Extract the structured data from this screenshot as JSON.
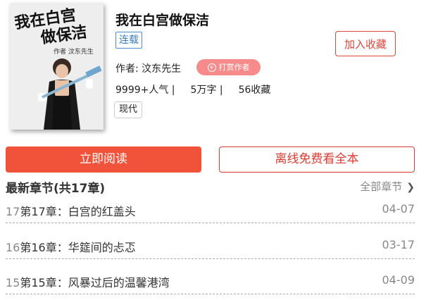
{
  "book": {
    "cover": {
      "title_line1": "我在白宫",
      "title_line2": "做保洁",
      "author_text": "作者 汶东先生"
    },
    "title": "我在白宫做保洁",
    "status_tag": "连载",
    "add_favorite_label": "加入收藏",
    "author_line": "作者: 汶东先生",
    "tip_label": "打赏作者",
    "stats": {
      "popularity": "9999+人气 |",
      "words": "5万字 |",
      "favorites": "56收藏"
    },
    "genre": "现代"
  },
  "actions": {
    "read_now": "立即阅读",
    "offline_read": "离线免费看全本"
  },
  "chapters": {
    "header": "最新章节(共17章)",
    "all_chapters": "全部章节",
    "items": [
      {
        "num": "17",
        "title": "第17章：白宫的红盖头",
        "date": "04-07"
      },
      {
        "num": "16",
        "title": "第16章：华筵间的忐忑",
        "date": "03-17"
      },
      {
        "num": "15",
        "title": "第15章：风暴过后的温馨港湾",
        "date": "04-09"
      }
    ]
  },
  "colors": {
    "primary_red": "#f1533a",
    "outline_red": "#d93b33",
    "tag_blue": "#3a7fc4",
    "tip_pink": "#f78a8a"
  }
}
